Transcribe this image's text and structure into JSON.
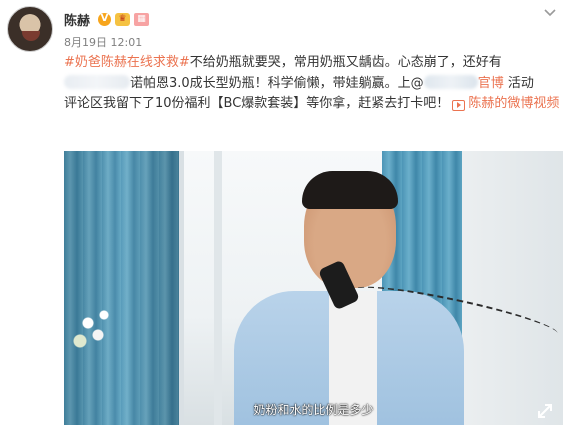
{
  "post": {
    "author": {
      "name": "陈赫",
      "badges": [
        {
          "name": "verified-v-badge",
          "glyph": "V"
        },
        {
          "name": "vip-crown-badge",
          "glyph": "♛"
        },
        {
          "name": "level-badge",
          "glyph": "▦"
        }
      ]
    },
    "timestamp": "8月19日 12:01",
    "text": {
      "hashtag": "#奶爸陈赫在线求救#",
      "line1_rest": "不给奶瓶就要哭，常用奶瓶又龋齿。心态崩了，还好有",
      "line2": "诺帕恩3.0成长型奶瓶！科学偷懒，带娃躺赢。上@",
      "mention_tail": "官博",
      "line2_rest": " 活动",
      "line3": "评论区我留下了10份福利【BC爆款套装】等你拿，赶紧去打卡吧！",
      "video_link_label": "陈赫的微博视频"
    },
    "video": {
      "subtitle": "奶粉和水的比例是多少"
    }
  },
  "colors": {
    "link": "#eb7350",
    "text": "#333333",
    "meta": "#808080",
    "curtain": "#4a93b4"
  },
  "icons": {
    "menu": "chevron-down-icon",
    "video_link": "play-video-icon",
    "fullscreen": "expand-icon"
  }
}
